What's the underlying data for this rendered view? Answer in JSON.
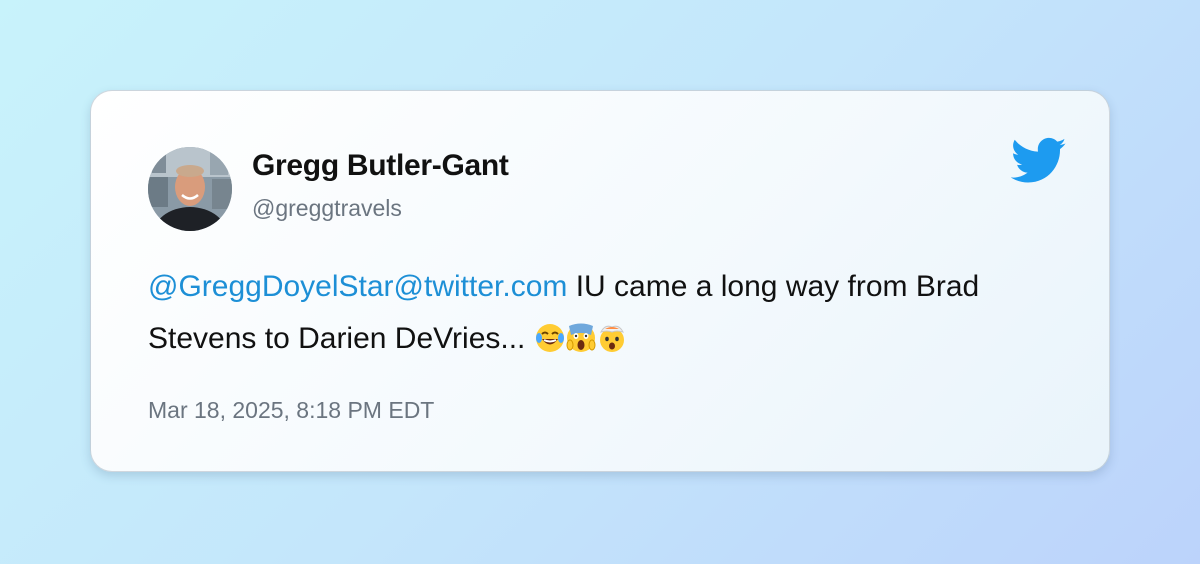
{
  "author": {
    "name": "Gregg Butler-Gant",
    "handle": "@greggtravels"
  },
  "tweet": {
    "mention": "@GreggDoyelStar@twitter.com",
    "text": " IU came a long way from Brad Stevens to Darien DeVries... ",
    "emojis": [
      "face-with-tears-of-joy-emoji",
      "face-screaming-in-fear-emoji",
      "exploding-head-emoji"
    ]
  },
  "timestamp": "Mar 18, 2025, 8:18 PM EDT",
  "icons": {
    "brand": "twitter-bird-icon"
  },
  "colors": {
    "accent": "#1d9bf0",
    "mention": "#1d8fd6",
    "muted": "#6b7580",
    "text": "#111111"
  }
}
